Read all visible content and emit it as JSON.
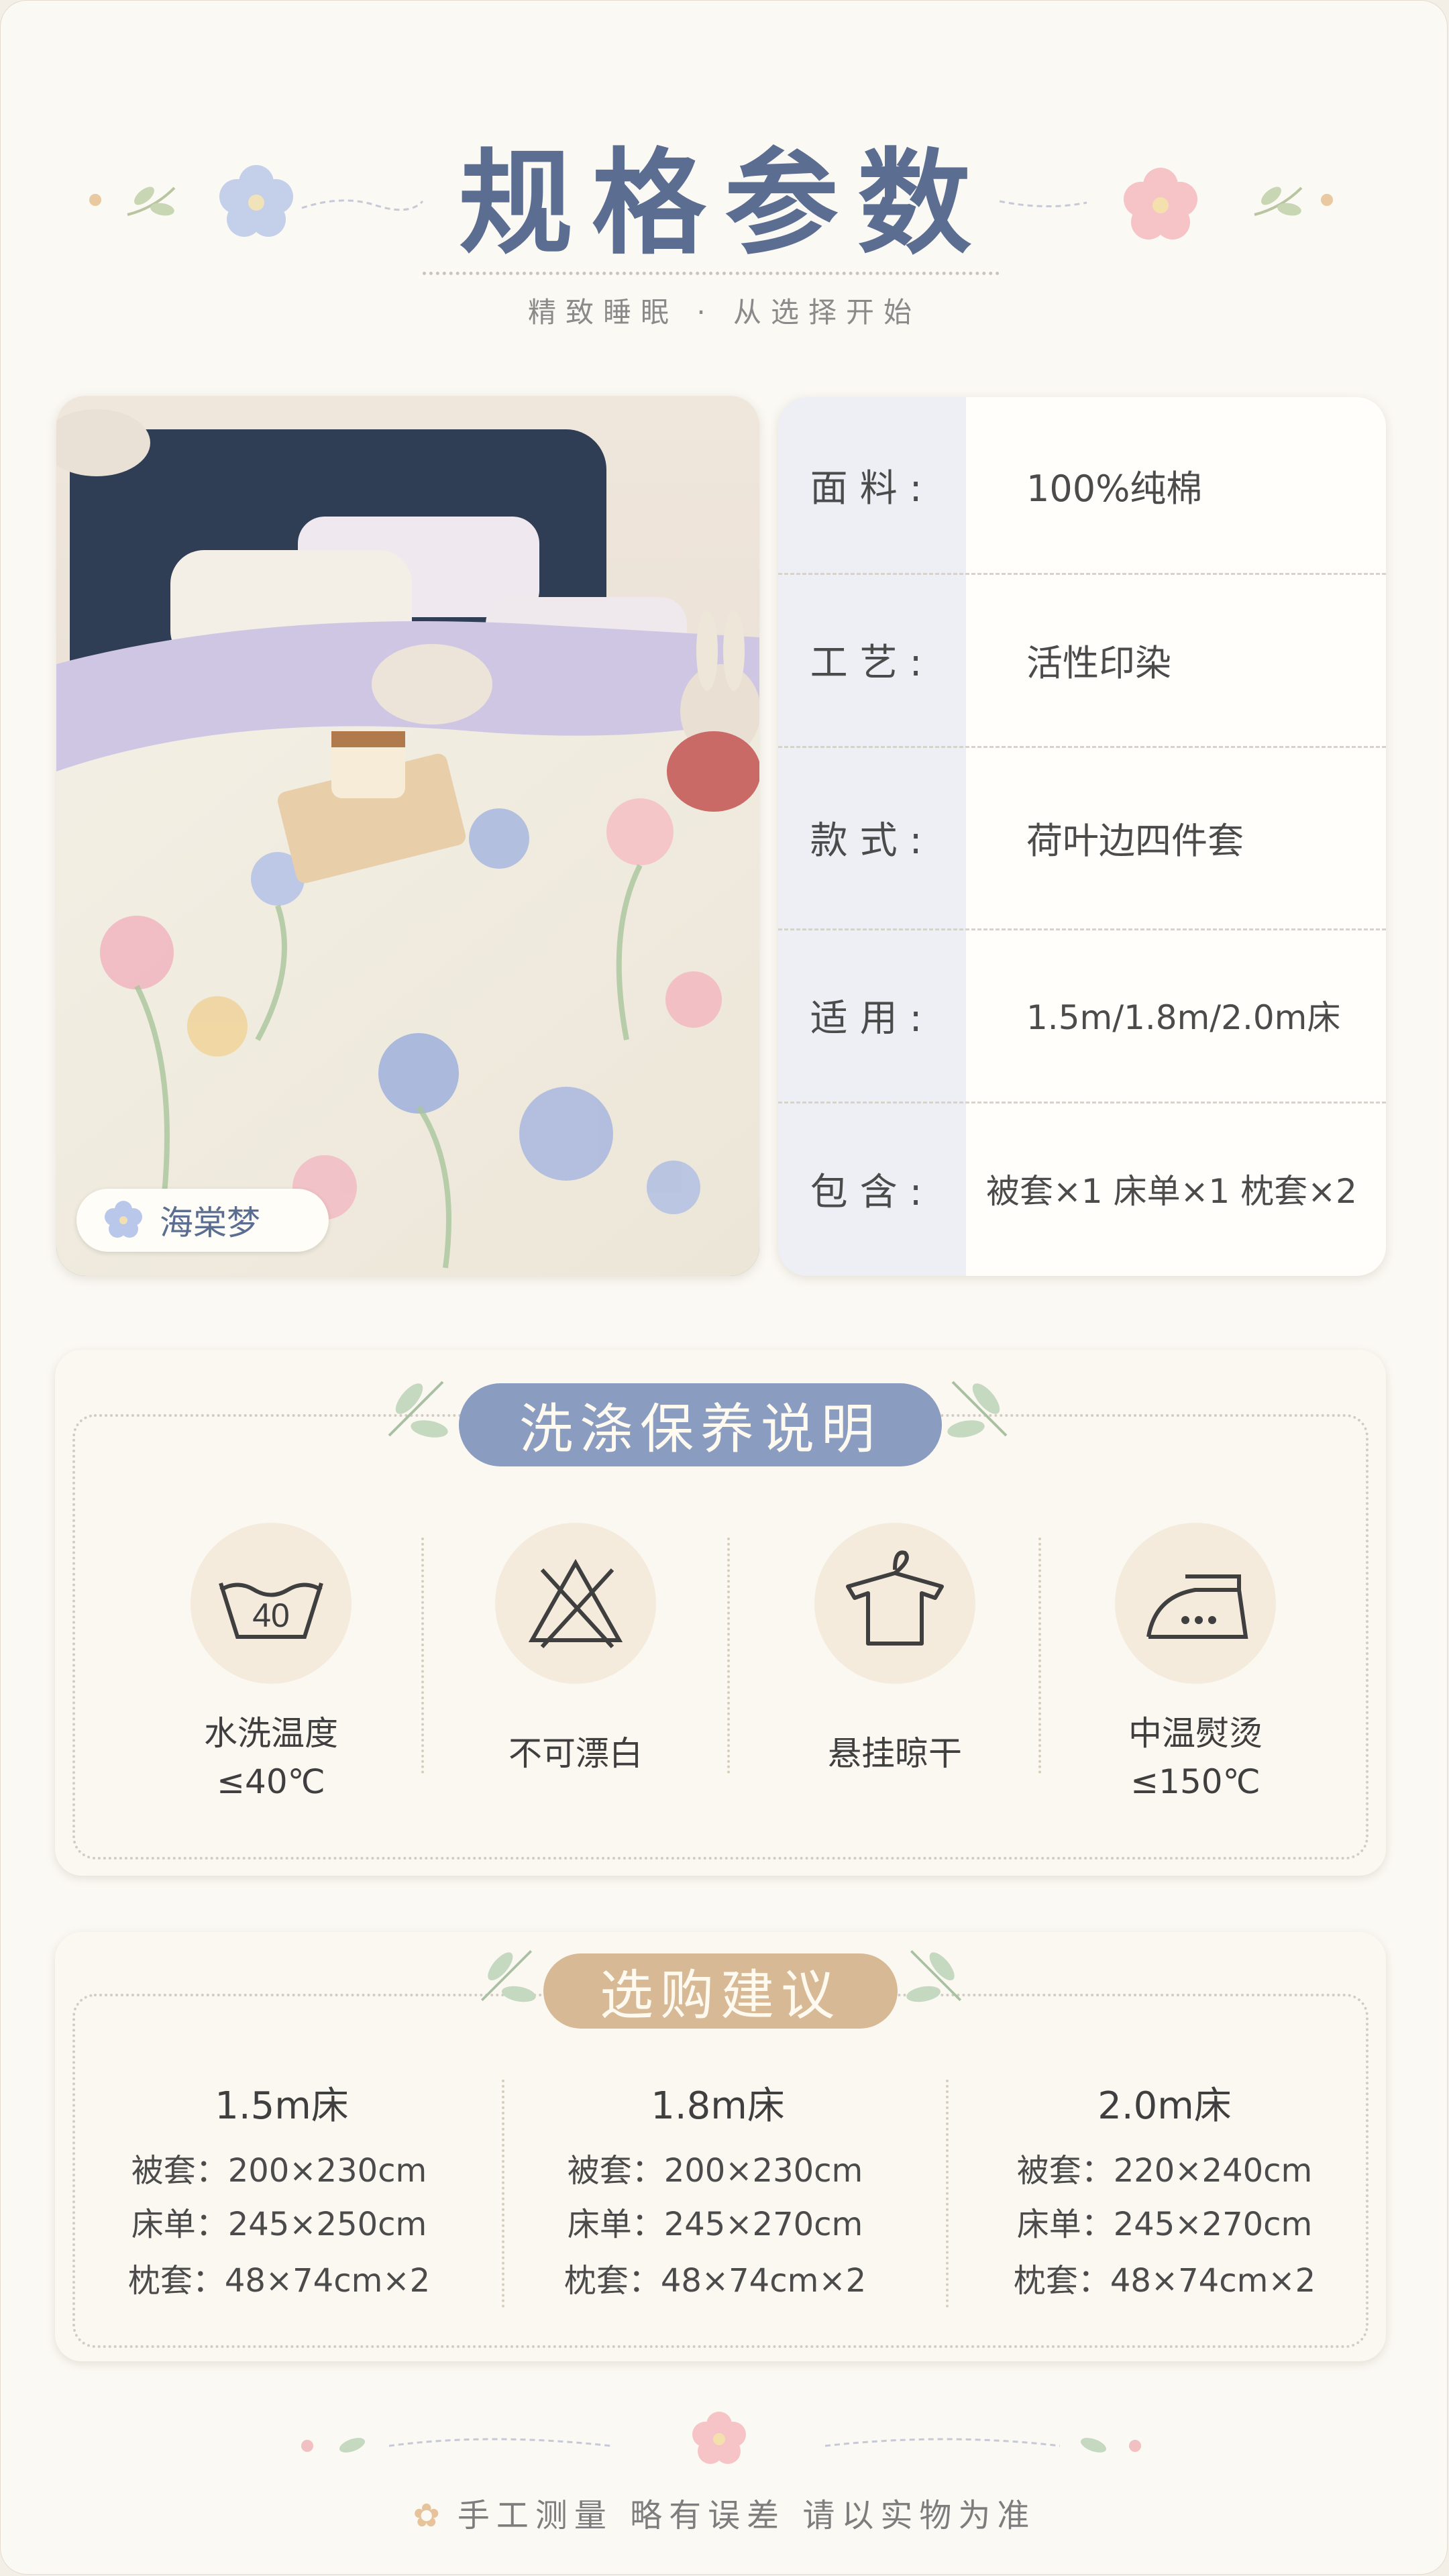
{
  "header": {
    "title": "规格参数",
    "subtitle": "精致睡眠 · 从选择开始"
  },
  "product": {
    "pattern_name": "海棠梦"
  },
  "specs": [
    {
      "label": "面料:",
      "value": "100%纯棉"
    },
    {
      "label": "工艺:",
      "value": "活性印染"
    },
    {
      "label": "款式:",
      "value": "荷叶边四件套"
    },
    {
      "label": "适用:",
      "value": "1.5m/1.8m/2.0m床"
    },
    {
      "label": "包含:",
      "value": "被套×1 床单×1 枕套×2"
    }
  ],
  "care": {
    "title": "洗涤保养说明",
    "items": [
      {
        "icon": "wash-40-icon",
        "icon_text": "40",
        "line1": "水洗温度",
        "line2": "≤40℃"
      },
      {
        "icon": "no-bleach-icon",
        "line1": "不可漂白",
        "line2": ""
      },
      {
        "icon": "hang-dry-icon",
        "line1": "悬挂晾干",
        "line2": ""
      },
      {
        "icon": "iron-medium-icon",
        "line1": "中温熨烫",
        "line2": "≤150℃"
      }
    ]
  },
  "purchase": {
    "title": "选购建议",
    "sizes": [
      {
        "bed": "1.5m床",
        "lines": [
          "被套：200×230cm",
          "床单：245×250cm",
          "枕套：48×74cm×2"
        ]
      },
      {
        "bed": "1.8m床",
        "lines": [
          "被套：200×230cm",
          "床单：245×270cm",
          "枕套：48×74cm×2"
        ]
      },
      {
        "bed": "2.0m床",
        "lines": [
          "被套：220×240cm",
          "床单：245×270cm",
          "枕套：48×74cm×2"
        ]
      }
    ]
  },
  "footer": {
    "note": "手工测量 略有误差 请以实物为准"
  },
  "colors": {
    "title_blue": "#5b6d91",
    "care_pill": "#8a9cc0",
    "purchase_pill": "#d7b995",
    "flower_blue": "#a7b7dc",
    "flower_pink": "#f3b6bd"
  }
}
